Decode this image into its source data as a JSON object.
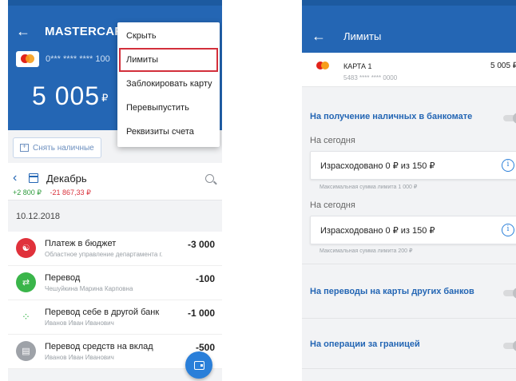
{
  "left": {
    "title": "MASTERCARD",
    "card_masked": "0*** **** **** 100",
    "balance": "5 005",
    "currency": "₽",
    "cash_button": "Снять наличные",
    "month": "Декабрь",
    "income": "+2 800 ₽",
    "expense": "-21 867,33 ₽",
    "date": "10.12.2018",
    "transactions": [
      {
        "name": "Платеж в бюджет",
        "sub": "Областное управление департамента г.",
        "amount": "-3 000",
        "color": "#e0313b",
        "icon": "budget-icon"
      },
      {
        "name": "Перевод",
        "sub": "Чешуйкина Марина Карповна",
        "amount": "-100",
        "color": "#3ab54a",
        "icon": "transfer-icon"
      },
      {
        "name": "Перевод себе в другой банк",
        "sub": "Иванов Иван Иванович",
        "amount": "-1 000",
        "color": "#ffffff",
        "icon": "loading-icon"
      },
      {
        "name": "Перевод средств на вклад",
        "sub": "Иванов Иван Иванович",
        "amount": "-500",
        "color": "#9ea2a8",
        "icon": "deposit-icon"
      }
    ],
    "menu": [
      "Скрыть",
      "Лимиты",
      "Заблокировать карту",
      "Перевыпустить",
      "Реквизиты счета"
    ]
  },
  "right": {
    "title": "Лимиты",
    "card_name": "КАРТА 1",
    "card_number": "5483 **** **** 0000",
    "card_balance": "5 005 ₽",
    "sections": {
      "cash": "На получение наличных в банкомате",
      "transfers": "На переводы на карты других банков",
      "abroad": "На операции за границей"
    },
    "today_label": "На сегодня",
    "limits": [
      {
        "spent": "Израсходовано 0 ₽ из 150 ₽",
        "max": "Максимальная сумма лимита 1 000 ₽"
      },
      {
        "spent": "Израсходовано 0 ₽ из 150 ₽",
        "max": "Максимальная сумма лимита 200 ₽"
      }
    ]
  }
}
